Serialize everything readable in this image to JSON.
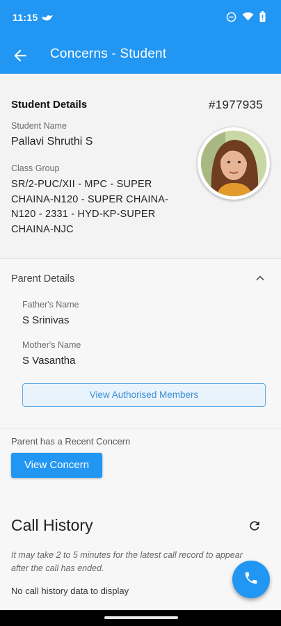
{
  "status_bar": {
    "time": "11:15",
    "app_icon": "bird-icon",
    "icons": [
      "do-not-disturb-icon",
      "wifi-icon",
      "battery-icon"
    ]
  },
  "app_bar": {
    "title": "Concerns - Student",
    "back_icon": "arrow-back-icon",
    "color": "#2196f3"
  },
  "student": {
    "section_title": "Student Details",
    "id": "#1977935",
    "name_label": "Student Name",
    "name": "Pallavi Shruthi S",
    "class_label": "Class Group",
    "class_value": "SR/2-PUC/XII - MPC - SUPER CHAINA-N120 - SUPER CHAINA-N120 - 2331 - HYD-KP-SUPER CHAINA-NJC"
  },
  "parent": {
    "section_title": "Parent Details",
    "father_label": "Father's Name",
    "father_name": "S Srinivas",
    "mother_label": "Mother's Name",
    "mother_name": "S Vasantha",
    "authorised_button": "View Authorised Members"
  },
  "concern": {
    "note": "Parent has a Recent Concern",
    "button": "View Concern"
  },
  "call_history": {
    "title": "Call History",
    "note": "It may take 2 to 5 minutes for the latest call record to appear after the call has ended.",
    "empty": "No call history data to display"
  }
}
